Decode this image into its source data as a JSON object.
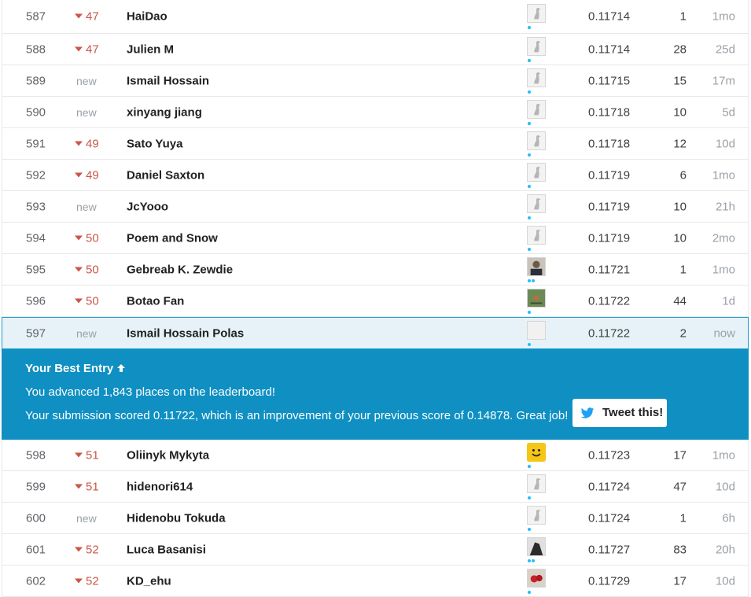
{
  "rows_before": [
    {
      "rank": "587",
      "change": "47",
      "is_new": false,
      "team": "HaiDao",
      "avatar": "default-goose-avatar",
      "score": "0.11714",
      "entries": "1",
      "last": "1mo"
    },
    {
      "rank": "588",
      "change": "47",
      "is_new": false,
      "team": "Julien M",
      "avatar": "default-goose-avatar",
      "score": "0.11714",
      "entries": "28",
      "last": "25d"
    },
    {
      "rank": "589",
      "change": "new",
      "is_new": true,
      "team": "Ismail Hossain",
      "avatar": "default-goose-avatar",
      "score": "0.11715",
      "entries": "15",
      "last": "17m"
    },
    {
      "rank": "590",
      "change": "new",
      "is_new": true,
      "team": "xinyang jiang",
      "avatar": "default-goose-avatar",
      "score": "0.11718",
      "entries": "10",
      "last": "5d"
    },
    {
      "rank": "591",
      "change": "49",
      "is_new": false,
      "team": "Sato Yuya",
      "avatar": "default-goose-avatar",
      "score": "0.11718",
      "entries": "12",
      "last": "10d"
    },
    {
      "rank": "592",
      "change": "49",
      "is_new": false,
      "team": "Daniel Saxton",
      "avatar": "default-goose-avatar",
      "score": "0.11719",
      "entries": "6",
      "last": "1mo"
    },
    {
      "rank": "593",
      "change": "new",
      "is_new": true,
      "team": "JcYooo",
      "avatar": "default-goose-avatar",
      "score": "0.11719",
      "entries": "10",
      "last": "21h"
    },
    {
      "rank": "594",
      "change": "50",
      "is_new": false,
      "team": "Poem and Snow",
      "avatar": "default-goose-avatar",
      "score": "0.11719",
      "entries": "10",
      "last": "2mo"
    },
    {
      "rank": "595",
      "change": "50",
      "is_new": false,
      "team": "Gebreab K. Zewdie",
      "avatar": "photo-avatar",
      "score": "0.11721",
      "entries": "1",
      "last": "1mo"
    },
    {
      "rank": "596",
      "change": "50",
      "is_new": false,
      "team": "Botao Fan",
      "avatar": "bird-photo-avatar",
      "score": "0.11722",
      "entries": "44",
      "last": "1d"
    }
  ],
  "your_row": {
    "rank": "597",
    "change": "new",
    "team": "Ismail Hossain Polas",
    "avatar": "default-goose-avatar",
    "score": "0.11722",
    "entries": "2",
    "last": "now"
  },
  "banner": {
    "title": "Your Best Entry",
    "line1": "You advanced 1,843 places on the leaderboard!",
    "line2": "Your submission scored 0.11722, which is an improvement of your previous score of 0.14878. Great job!",
    "tweet_label": "Tweet this!"
  },
  "rows_after": [
    {
      "rank": "598",
      "change": "51",
      "is_new": false,
      "team": "Oliinyk Mykyta",
      "avatar": "smiley-avatar",
      "score": "0.11723",
      "entries": "17",
      "last": "1mo"
    },
    {
      "rank": "599",
      "change": "51",
      "is_new": false,
      "team": "hidenori614",
      "avatar": "default-goose-avatar",
      "score": "0.11724",
      "entries": "47",
      "last": "10d"
    },
    {
      "rank": "600",
      "change": "new",
      "is_new": true,
      "team": "Hidenobu Tokuda",
      "avatar": "default-goose-avatar",
      "score": "0.11724",
      "entries": "1",
      "last": "6h"
    },
    {
      "rank": "601",
      "change": "52",
      "is_new": false,
      "team": "Luca Basanisi",
      "avatar": "bw-photo-avatar",
      "score": "0.11727",
      "entries": "83",
      "last": "20h"
    },
    {
      "rank": "602",
      "change": "52",
      "is_new": false,
      "team": "KD_ehu",
      "avatar": "red-photo-avatar",
      "score": "0.11729",
      "entries": "17",
      "last": "10d"
    }
  ],
  "colors": {
    "accent": "#0f8fc2",
    "down": "#c9574a",
    "highlight_row": "#e6f2f8"
  }
}
